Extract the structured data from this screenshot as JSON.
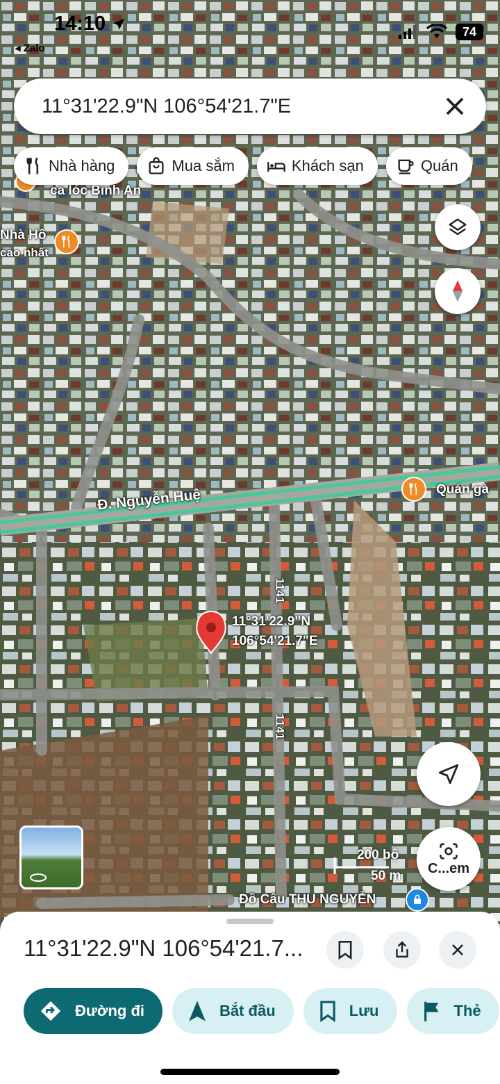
{
  "status_bar": {
    "time": "14:10",
    "back_app": "◂ Zalo",
    "battery": "74"
  },
  "search": {
    "query": "11°31'22.9\"N 106°54'21.7\"E"
  },
  "chips": [
    {
      "label": "Nhà hàng",
      "icon": "restaurant-icon"
    },
    {
      "label": "Mua sắm",
      "icon": "shopping-bag-icon"
    },
    {
      "label": "Khách sạn",
      "icon": "bed-icon"
    },
    {
      "label": "Quán",
      "icon": "coffee-icon"
    }
  ],
  "map": {
    "labels": {
      "poi_top_1": "cá lóc Bình An",
      "poi_top_2_line1": "Nhà Hồ",
      "poi_top_2_line2": "cao nhất",
      "road_main": "Đ. Nguyễn Huệ",
      "poi_right": "Quán gà",
      "road_1141_a": "1141",
      "road_1141_b": "1141",
      "pin_line1": "11°31'22.9\"N",
      "pin_line2": "106°54'21.7\"E",
      "poi_bottom": "Đồ Câu THU NGUYỄN",
      "partial_label": "Cá"
    },
    "scale": {
      "feet": "200 bộ",
      "meters": "50 m"
    },
    "camera_button_label": "C...em"
  },
  "sheet": {
    "title": "11°31'22.9\"N 106°54'21.7...",
    "actions": [
      {
        "label": "Đường đi",
        "icon": "directions-icon",
        "style": "primary"
      },
      {
        "label": "Bắt đầu",
        "icon": "navigation-arrow-icon",
        "style": "secondary"
      },
      {
        "label": "Lưu",
        "icon": "bookmark-icon",
        "style": "secondary"
      },
      {
        "label": "Thẻ",
        "icon": "flag-icon",
        "style": "secondary"
      }
    ]
  },
  "colors": {
    "primary": "#0e6a72",
    "secondary_bg": "#d6f0f4",
    "pin": "#e53935",
    "poi": "#f08a24"
  }
}
